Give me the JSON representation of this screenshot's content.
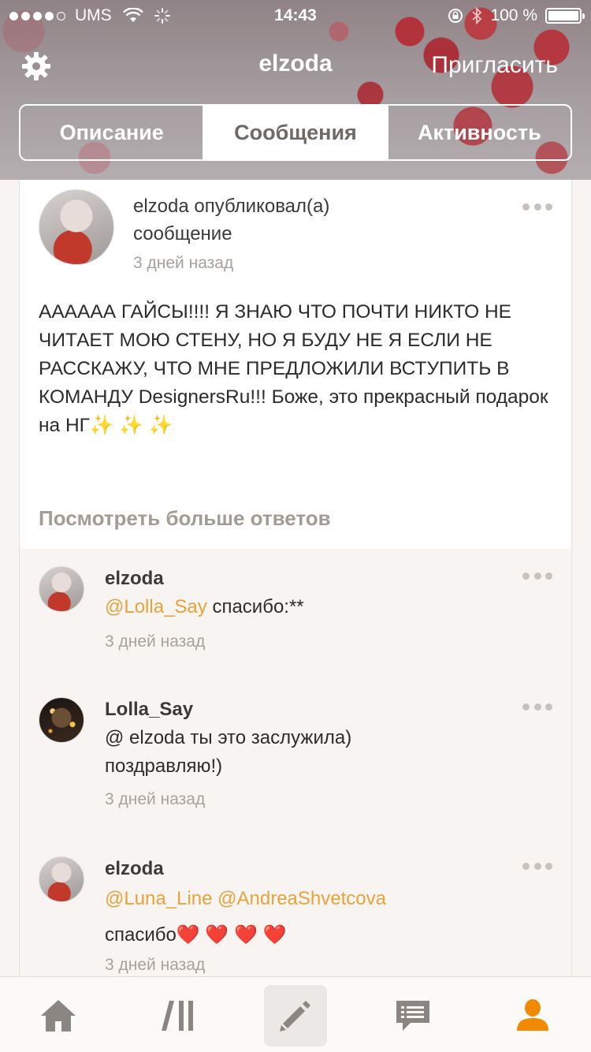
{
  "status_bar": {
    "carrier": "UMS",
    "time": "14:43",
    "battery": "100 %"
  },
  "nav": {
    "title": "elzoda",
    "invite_label": "Пригласить"
  },
  "segments": [
    {
      "label": "Описание",
      "active": false
    },
    {
      "label": "Сообщения",
      "active": true
    },
    {
      "label": "Активность",
      "active": false
    }
  ],
  "post": {
    "header_line1": "elzoda опубликовал(а)",
    "header_line2": "сообщение",
    "time": "3 дней назад",
    "body": "АААААА ГАЙСЫ!!!! Я ЗНАЮ ЧТО ПОЧТИ НИКТО НЕ ЧИТАЕТ МОЮ СТЕНУ, НО Я БУДУ НЕ Я ЕСЛИ НЕ РАССКАЖУ, ЧТО МНЕ ПРЕДЛОЖИЛИ ВСТУПИТЬ В КОМАНДУ DesignersRu!!! Боже, это прекрасный подарок на НГ✨ ✨ ✨"
  },
  "see_more": "Посмотреть больше ответов",
  "replies": [
    {
      "author": "elzoda",
      "mention": "@Lolla_Say",
      "text": " спасибо:**",
      "time": "3 дней назад"
    },
    {
      "author": "Lolla_Say",
      "mention": "",
      "text": "@ elzoda  ты это заслужила) поздравляю!)",
      "time": "3 дней назад"
    },
    {
      "author": "elzoda",
      "mention": "@Luna_Line @AndreaShvetcova",
      "text": "спасибо❤️ ❤️ ❤️ ❤️",
      "time": "3 дней назад"
    }
  ],
  "colors": {
    "accent": "#e8a33c",
    "tab_active": "#f08a00",
    "text_muted": "#a8a29c"
  }
}
